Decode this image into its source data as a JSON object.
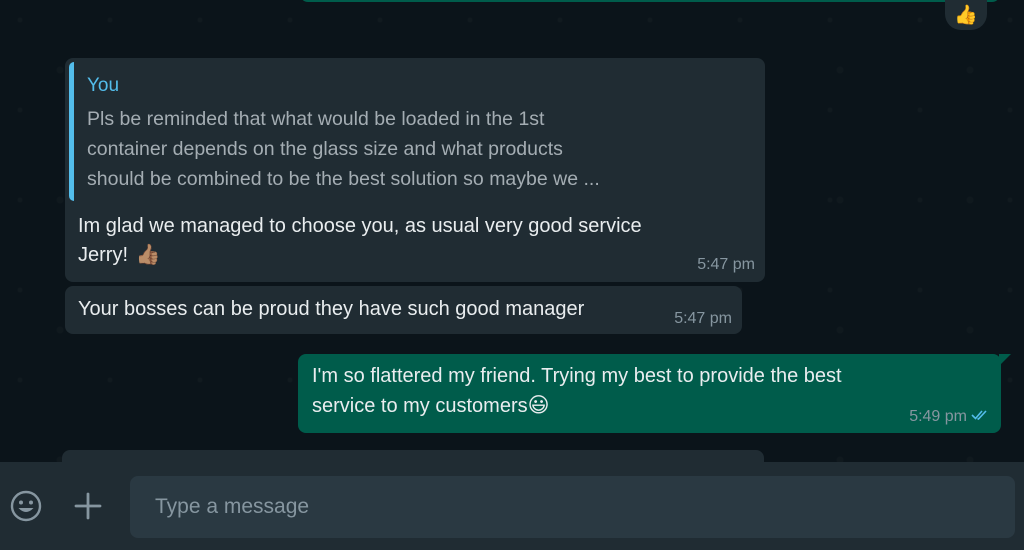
{
  "conversation": {
    "prev_reaction": "👍",
    "messages": [
      {
        "direction": "incoming",
        "quote_author": "You",
        "quote_lines": [
          "Pls be reminded that what would be loaded in the 1st",
          "container depends on the glass size and what products",
          "should be combined to be the best solution so maybe we ..."
        ],
        "text_line1": "Im glad we managed to choose you, as usual very good service",
        "text_line2": "Jerry!",
        "emoji": "👍🏽",
        "time": "5:47 pm"
      },
      {
        "direction": "incoming",
        "text": "Your bosses can be proud they have such good manager",
        "time": "5:47 pm"
      },
      {
        "direction": "outgoing",
        "text_line1": "I'm so flattered my friend. Trying my best to provide the best",
        "text_line2": "service to my customers",
        "emoji": "😃",
        "time": "5:49 pm",
        "status": "read"
      }
    ]
  },
  "composer": {
    "placeholder": "Type a message",
    "emoji_icon": "emoji-icon",
    "attach_icon": "plus-icon"
  },
  "colors": {
    "background": "#0b141a",
    "incoming_bubble": "#202c33",
    "outgoing_bubble": "#005c4b",
    "accent": "#53bdeb",
    "meta_text": "#8696a0"
  }
}
